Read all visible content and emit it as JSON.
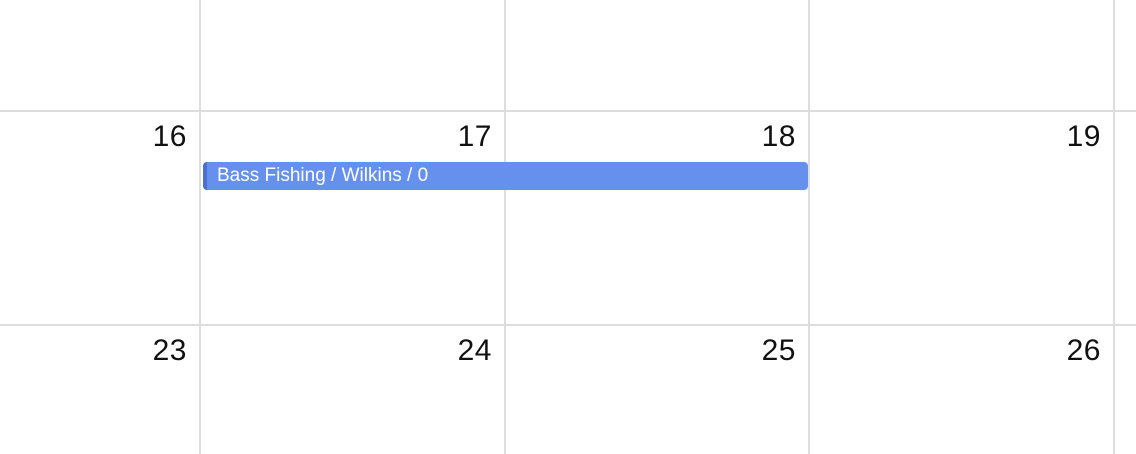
{
  "calendar": {
    "weeks": [
      {
        "days": [
          "",
          "",
          "",
          ""
        ]
      },
      {
        "days": [
          "16",
          "17",
          "18",
          "19"
        ]
      },
      {
        "days": [
          "23",
          "24",
          "25",
          "26"
        ]
      }
    ],
    "events": [
      {
        "label": "Bass Fishing / Wilkins / 0",
        "color": "#6590ed"
      }
    ]
  },
  "colors": {
    "grid_line": "#dddddd",
    "event_fill": "#6590ed",
    "event_accent": "#4a6fcf",
    "day_text": "#111111"
  }
}
